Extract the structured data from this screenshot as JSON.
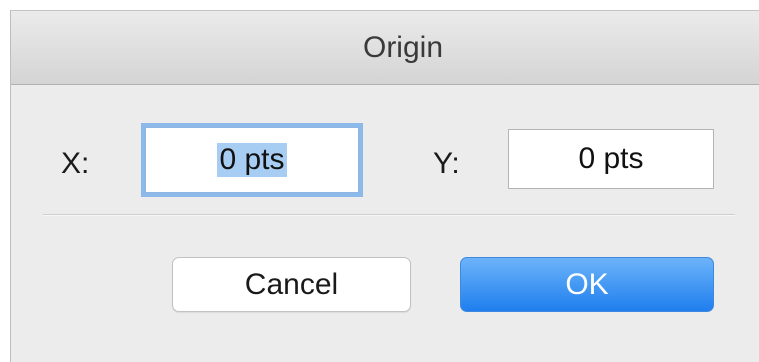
{
  "dialog": {
    "title": "Origin",
    "fields": {
      "x": {
        "label": "X:",
        "value": "0 pts",
        "focused": true,
        "selected_text": "0 pts"
      },
      "y": {
        "label": "Y:",
        "value": "0 pts"
      }
    },
    "buttons": {
      "cancel_label": "Cancel",
      "ok_label": "OK"
    }
  },
  "colors": {
    "focus_ring": "#8cb8ea",
    "selection": "#a8cdf3",
    "ok_button": "#2b86f0"
  }
}
